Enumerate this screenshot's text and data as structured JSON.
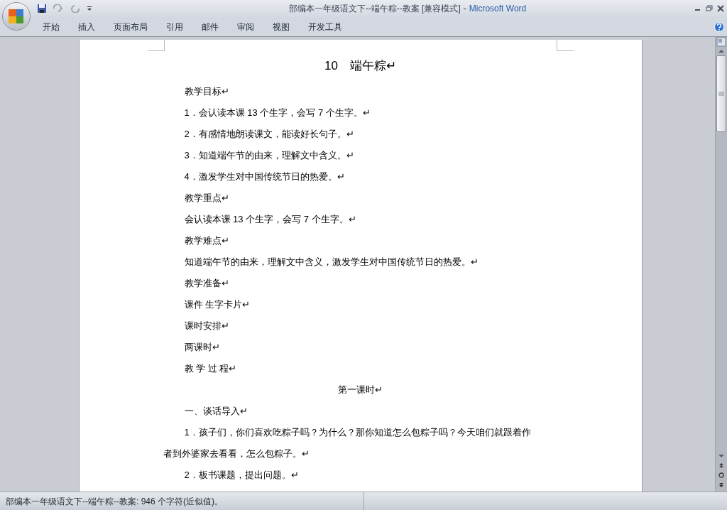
{
  "window": {
    "document_title": "部编本一年级语文下--端午粽--教案 [兼容模式]",
    "separator": "-",
    "app_name": "Microsoft Word"
  },
  "tabs": [
    {
      "label": "开始",
      "selected": false
    },
    {
      "label": "插入",
      "selected": false
    },
    {
      "label": "页面布局",
      "selected": false
    },
    {
      "label": "引用",
      "selected": false
    },
    {
      "label": "邮件",
      "selected": false
    },
    {
      "label": "审阅",
      "selected": false
    },
    {
      "label": "视图",
      "selected": false
    },
    {
      "label": "开发工具",
      "selected": false
    }
  ],
  "document": {
    "title": "10　端午粽↵",
    "paragraphs": [
      {
        "kind": "indent",
        "text": "教学目标↵"
      },
      {
        "kind": "indent",
        "text": "1．会认读本课 13 个生字，会写 7 个生字。↵"
      },
      {
        "kind": "indent",
        "text": "2．有感情地朗读课文，能读好长句子。↵"
      },
      {
        "kind": "indent",
        "text": "3．知道端午节的由来，理解文中含义。↵"
      },
      {
        "kind": "indent",
        "text": "4．激发学生对中国传统节日的热爱。↵"
      },
      {
        "kind": "indent",
        "text": "教学重点↵"
      },
      {
        "kind": "indent",
        "text": "会认读本课 13 个生字，会写 7 个生字。↵"
      },
      {
        "kind": "indent",
        "text": "教学难点↵"
      },
      {
        "kind": "indent",
        "text": "知道端午节的由来，理解文中含义，激发学生对中国传统节日的热爱。↵"
      },
      {
        "kind": "indent",
        "text": "教学准备↵"
      },
      {
        "kind": "indent",
        "text": "课件 生字卡片↵"
      },
      {
        "kind": "indent",
        "text": "课时安排↵"
      },
      {
        "kind": "indent",
        "text": "两课时↵"
      },
      {
        "kind": "indent",
        "text": "教 学 过 程↵"
      },
      {
        "kind": "center",
        "text": "第一课时↵"
      },
      {
        "kind": "indent",
        "text": "一、谈话导入↵"
      },
      {
        "kind": "indent",
        "text": "1．孩子们，你们喜欢吃粽子吗？为什么？那你知道怎么包粽子吗？今天咱们就跟着作"
      },
      {
        "kind": "wrap",
        "text": "者到外婆家去看看，怎么包粽子。↵"
      },
      {
        "kind": "indent",
        "text": "2．板书课题，提出问题。↵"
      }
    ]
  },
  "status_bar": {
    "text": "部编本一年级语文下--端午粽--教案: 946 个字符(近似值)。"
  }
}
